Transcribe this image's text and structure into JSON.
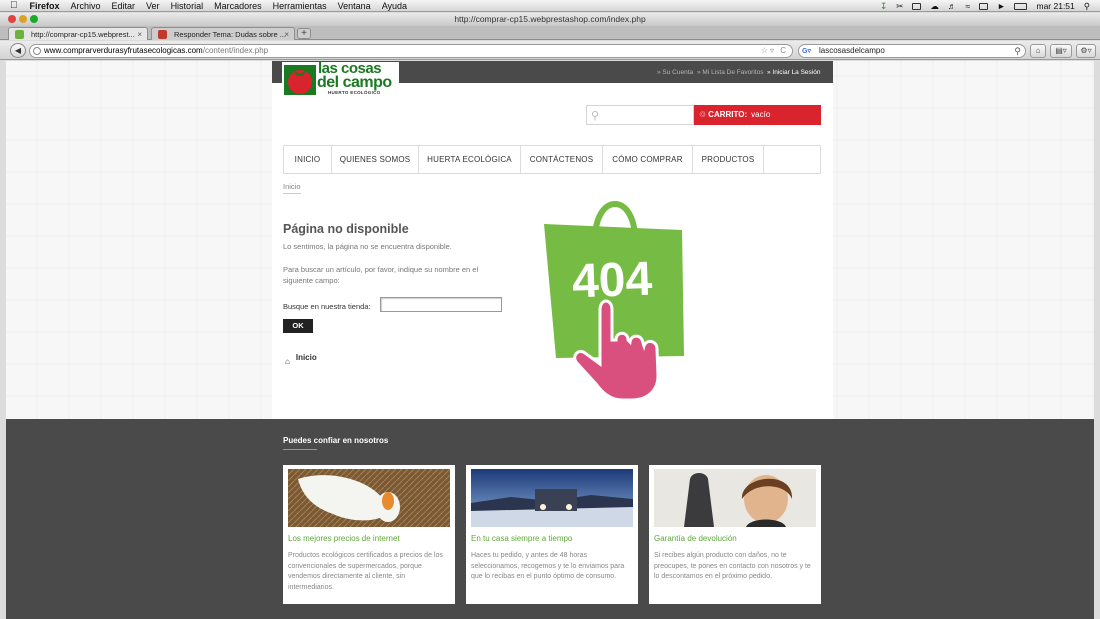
{
  "menubar": {
    "app": "Firefox",
    "items": [
      "Archivo",
      "Editar",
      "Ver",
      "Historial",
      "Marcadores",
      "Herramientas",
      "Ventana",
      "Ayuda"
    ],
    "clock": "mar 21:51"
  },
  "window": {
    "title": "http://comprar-cp15.webprestashop.com/index.php"
  },
  "tabs": [
    {
      "label": "http://comprar-cp15.webprest..."
    },
    {
      "label": "Responder Tema: Dudas sobre ..."
    }
  ],
  "navbar": {
    "url_domain": "www.comprarverdurasyfrutasecologicas.com",
    "url_path": "/content/index.php",
    "search_value": "lascosasdelcampo"
  },
  "site": {
    "logo": {
      "line1": "las cosas",
      "line2": "del campo",
      "tagline": "HUERTO ECOLÓGICO"
    },
    "toplinks": [
      "» Su Cuenta",
      "» Mi Lista De Favoritos",
      "» Iniciar La Sesión"
    ],
    "cart": {
      "label": "CARRITO:",
      "value": "vacío"
    },
    "menu": [
      "INICIO",
      "QUIENES SOMOS",
      "HUERTA ECOLÓGICA",
      "CONTÁCTENOS",
      "CÓMO COMPRAR",
      "PRODUCTOS",
      ""
    ],
    "breadcrumb": "Inicio",
    "error": {
      "title": "Página no disponible",
      "message": "Lo sentimos, la página no se encuentra disponible.",
      "hint": "Para buscar un artículo, por favor, indique su nombre en el siguiente campo:",
      "search_label": "Busque en nuestra tienda:",
      "ok": "OK",
      "home": "Inicio",
      "code": "404"
    },
    "footer": {
      "title": "Puedes confiar en nosotros",
      "cards": [
        {
          "title": "Los mejores precios de internet",
          "text": "Productos ecológicos certificados a precios de los convencionales de supermercados, porque vendemos directamente al cliente, sin intermediarios."
        },
        {
          "title": "En tu casa siempre a tiempo",
          "text": "Haces tu pedido, y antes de 48 horas seleccionamos, recogemos y te lo enviamos para que lo recibas en el punto óptimo de consumo."
        },
        {
          "title": "Garantía de devolución",
          "text": "Si recibes algún producto con daños, no te preocupes, te pones en contacto con nosotros y te lo descontamos en el próximo pedido."
        }
      ]
    }
  },
  "colors": {
    "accent_red": "#d9232d",
    "brand_green": "#1a7a22",
    "bag_green": "#76bb44",
    "hand_pink": "#d94f7e",
    "dark_band": "#4a4a4a"
  }
}
